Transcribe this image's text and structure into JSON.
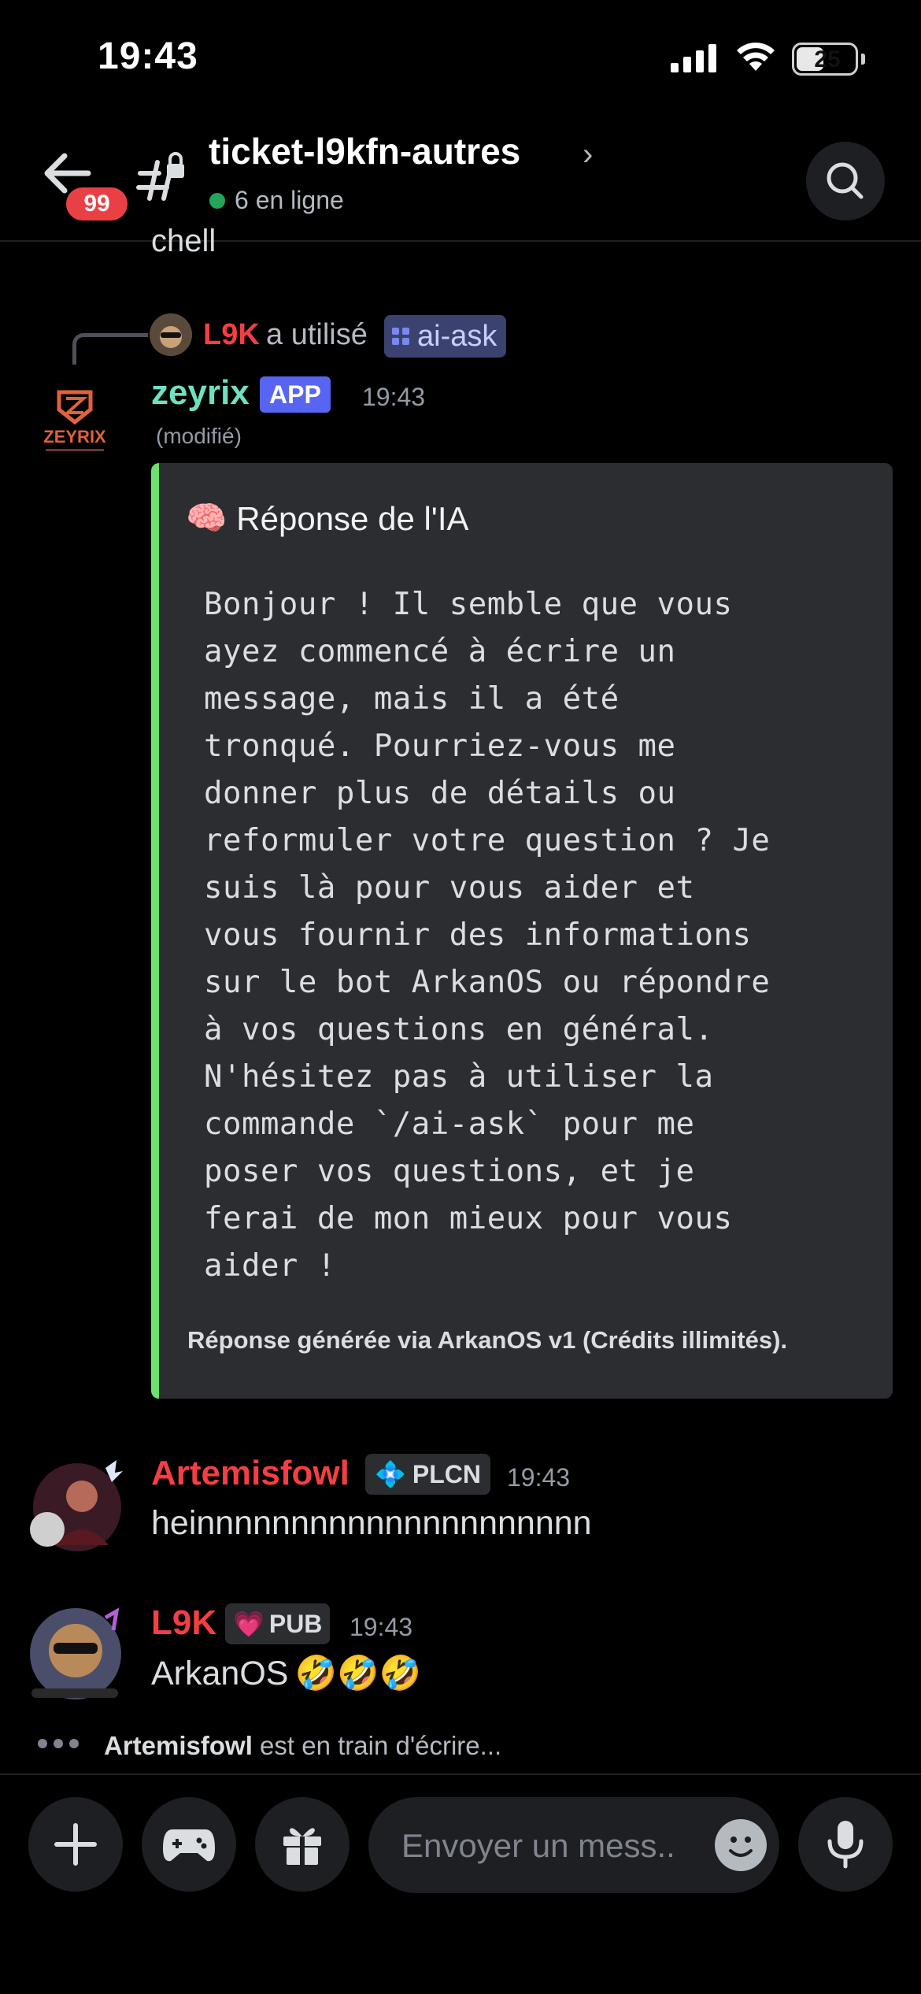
{
  "status_bar": {
    "time": "19:43",
    "battery": "25"
  },
  "header": {
    "unread_badge": "99",
    "channel_name": "ticket-l9kfn-autres",
    "chevron": "›",
    "online_text": "6 en ligne"
  },
  "partial_prev_text": "chell",
  "reply": {
    "user": "L9K",
    "used_text": "a utilisé",
    "command": "ai-ask"
  },
  "bot_message": {
    "author": "zeyrix",
    "avatar_text": "ZEYRIX",
    "tag": "APP",
    "time": "19:43",
    "edited": "(modifié)",
    "embed": {
      "title_emoji": "🧠",
      "title": "Réponse de l'IA",
      "body": "Bonjour ! Il semble que vous\nayez commencé à écrire un\nmessage, mais il a été\ntronqué. Pourriez-vous me\ndonner plus de détails ou\nreformuler votre question ? Je\nsuis là pour vous aider et\nvous fournir des informations\nsur le bot ArkanOS ou répondre\nà vos questions en général.\nN'hésitez pas à utiliser la\ncommande `/ai-ask` pour me\nposer vos questions, et je\nferai de mon mieux pour vous\naider !",
      "footer": "Réponse générée via ArkanOS v1 (Crédits illimités).",
      "accent_color": "#6ee06e"
    }
  },
  "messages": [
    {
      "author": "Artemisfowl",
      "tag_icon": "💠",
      "tag": "PLCN",
      "time": "19:43",
      "text": "heinnnnnnnnnnnnnnnnnnnnn"
    },
    {
      "author": "L9K",
      "tag_icon": "💗",
      "tag": "PUB",
      "time": "19:43",
      "text": "ArkanOS",
      "emojis": "🤣🤣🤣"
    }
  ],
  "typing": {
    "user": "Artemisfowl",
    "text": "est en train d'écrire..."
  },
  "composer": {
    "placeholder": "Envoyer un mess.."
  },
  "colors": {
    "accent": "#5865f2",
    "username_red": "#f23f43",
    "bot_name": "#6fe0c0",
    "online": "#23a55a"
  }
}
